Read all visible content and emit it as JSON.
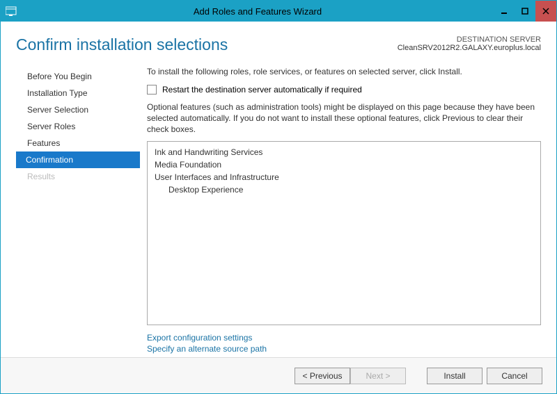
{
  "titlebar": {
    "title": "Add Roles and Features Wizard"
  },
  "page": {
    "title": "Confirm installation selections",
    "destination_label": "DESTINATION SERVER",
    "destination_server": "CleanSRV2012R2.GALAXY.europlus.local"
  },
  "sidebar": {
    "items": [
      {
        "label": "Before You Begin",
        "state": "normal"
      },
      {
        "label": "Installation Type",
        "state": "normal"
      },
      {
        "label": "Server Selection",
        "state": "normal"
      },
      {
        "label": "Server Roles",
        "state": "normal"
      },
      {
        "label": "Features",
        "state": "normal"
      },
      {
        "label": "Confirmation",
        "state": "active"
      },
      {
        "label": "Results",
        "state": "disabled"
      }
    ]
  },
  "main": {
    "description": "To install the following roles, role services, or features on selected server, click Install.",
    "restart_checkbox_label": "Restart the destination server automatically if required",
    "optional_note": "Optional features (such as administration tools) might be displayed on this page because they have been selected automatically. If you do not want to install these optional features, click Previous to clear their check boxes.",
    "features": [
      {
        "label": "Ink and Handwriting Services",
        "indent": 0
      },
      {
        "label": "Media Foundation",
        "indent": 0
      },
      {
        "label": "User Interfaces and Infrastructure",
        "indent": 0
      },
      {
        "label": "Desktop Experience",
        "indent": 1
      }
    ],
    "links": {
      "export": "Export configuration settings",
      "alt_source": "Specify an alternate source path"
    }
  },
  "footer": {
    "previous": "< Previous",
    "next": "Next >",
    "install": "Install",
    "cancel": "Cancel"
  }
}
